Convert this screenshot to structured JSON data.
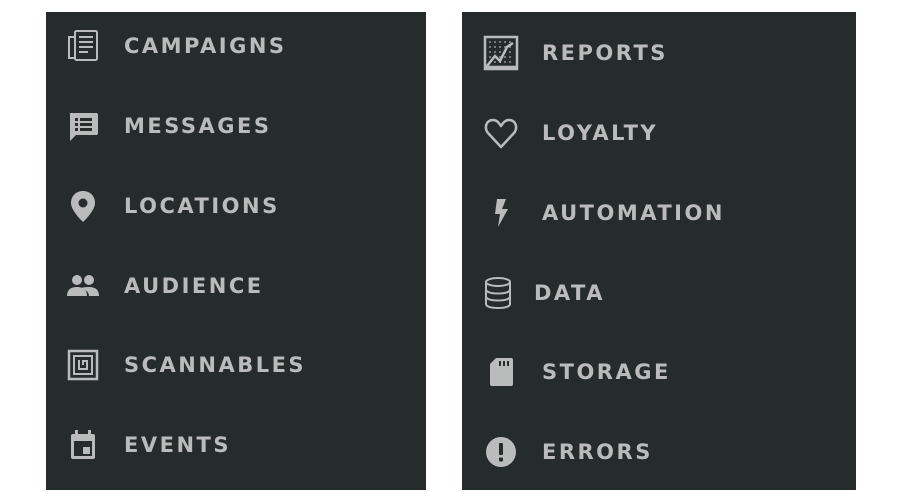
{
  "left_menu": {
    "items": [
      {
        "label": "CAMPAIGNS",
        "icon": "campaigns-icon"
      },
      {
        "label": "MESSAGES",
        "icon": "messages-icon"
      },
      {
        "label": "LOCATIONS",
        "icon": "location-pin-icon"
      },
      {
        "label": "AUDIENCE",
        "icon": "people-icon"
      },
      {
        "label": "SCANNABLES",
        "icon": "scannables-icon"
      },
      {
        "label": "EVENTS",
        "icon": "calendar-icon"
      }
    ]
  },
  "right_menu": {
    "items": [
      {
        "label": "REPORTS",
        "icon": "chart-icon"
      },
      {
        "label": "LOYALTY",
        "icon": "heart-icon"
      },
      {
        "label": "AUTOMATION",
        "icon": "lightning-icon"
      },
      {
        "label": "DATA",
        "icon": "database-icon"
      },
      {
        "label": "STORAGE",
        "icon": "sd-card-icon"
      },
      {
        "label": "ERRORS",
        "icon": "alert-icon"
      }
    ]
  },
  "colors": {
    "panel_background": "#262c2c",
    "text": "#b9bcba",
    "icon": "#b9bcba"
  }
}
